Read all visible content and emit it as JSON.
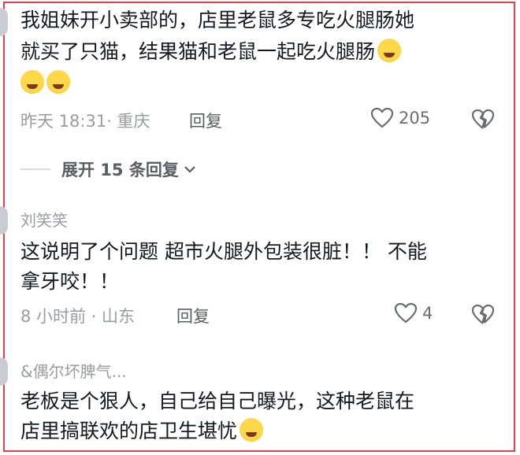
{
  "comment1": {
    "line1": "我姐妹开小卖部的，店里老鼠多专吃火腿肠她",
    "line2": "就买了只猫，结果猫和老鼠一起吃火腿肠",
    "emoji": "laugh-cry-emoji",
    "meta": "昨天 18:31· 重庆",
    "reply": "回复",
    "likes": "205"
  },
  "expand_label": "展开 15 条回复",
  "comment2": {
    "username": "刘笑笑",
    "line1": "这说明了个问题  超市火腿外包装很脏！！ 不能",
    "line2": "拿牙咬！！",
    "meta": "8 小时前 · 山东",
    "reply": "回复",
    "likes": "4"
  },
  "comment3": {
    "username": "&偶尔坏脾气...",
    "line1": "老板是个狠人，自己给自己曝光，这种老鼠在",
    "line2": "店里搞联欢的店卫生堪忧"
  },
  "colors": {
    "border": "#e8404a",
    "text": "#161823",
    "muted": "#9a9ca3"
  }
}
